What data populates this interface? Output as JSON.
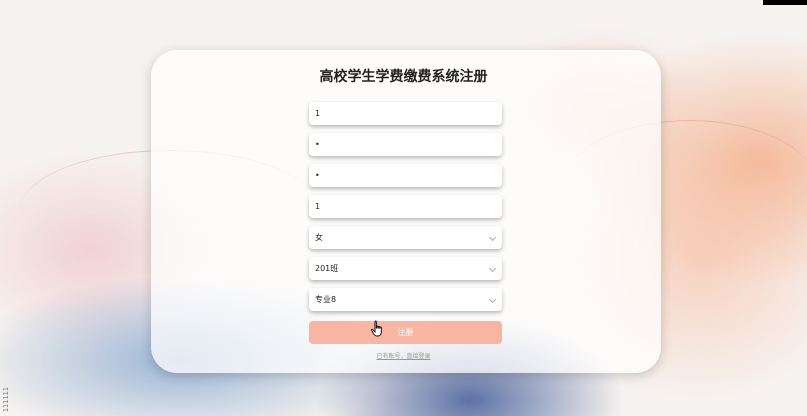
{
  "form": {
    "title": "高校学生学费缴费系统注册",
    "fields": [
      {
        "name": "username",
        "value": "1"
      },
      {
        "name": "password",
        "value": "•"
      },
      {
        "name": "confirm",
        "value": "•"
      },
      {
        "name": "realname",
        "value": "1"
      }
    ],
    "selects": [
      {
        "name": "gender",
        "value": "女"
      },
      {
        "name": "class",
        "value": "201班"
      },
      {
        "name": "major",
        "value": "专业8"
      }
    ],
    "register_label": "注册",
    "login_link": "已有账号，直接登录"
  },
  "side_label": "111111",
  "colors": {
    "accent": "#f8b6a2",
    "title": "#222222"
  }
}
